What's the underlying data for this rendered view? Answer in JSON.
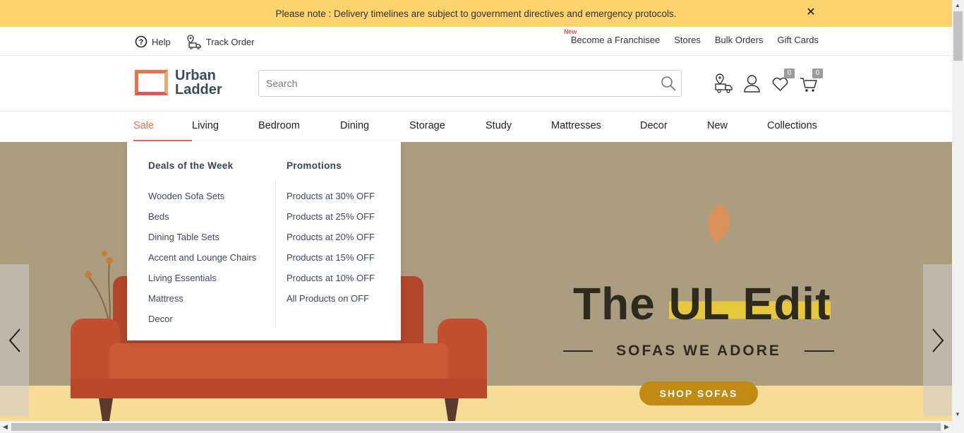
{
  "notice": {
    "text": "Please note : Delivery timelines are subject to government directives and emergency protocols.",
    "close": "✕"
  },
  "utility": {
    "help": "Help",
    "track_order": "Track Order",
    "new_tag": "New",
    "franchisee": "Become a Franchisee",
    "stores": "Stores",
    "bulk_orders": "Bulk Orders",
    "gift_cards": "Gift Cards"
  },
  "header": {
    "logo_line1": "Urban",
    "logo_line2": "Ladder",
    "search_placeholder": "Search",
    "wishlist_count": "0",
    "cart_count": "0"
  },
  "nav": {
    "items": [
      "Sale",
      "Living",
      "Bedroom",
      "Dining",
      "Storage",
      "Study",
      "Mattresses",
      "Decor",
      "New",
      "Collections"
    ],
    "active": "Sale"
  },
  "dropdown": {
    "col1": {
      "heading": "Deals of the Week",
      "links": [
        "Wooden Sofa Sets",
        "Beds",
        "Dining Table Sets",
        "Accent and Lounge Chairs",
        "Living Essentials",
        "Mattress",
        "Decor"
      ]
    },
    "col2": {
      "heading": "Promotions",
      "links": [
        "Products at 30% OFF",
        "Products at 25% OFF",
        "Products at 20% OFF",
        "Products at 15% OFF",
        "Products at 10% OFF",
        "All Products on OFF"
      ]
    }
  },
  "hero": {
    "title_pre": "The ",
    "title_hl": "UL Edit",
    "subtitle": "SOFAS WE ADORE",
    "cta": "SHOP SOFAS"
  },
  "colors": {
    "accent": "#e8724c",
    "notice_bg": "#fdd36c",
    "hero_bg": "#ab9d7f",
    "cta": "#c18a12"
  }
}
